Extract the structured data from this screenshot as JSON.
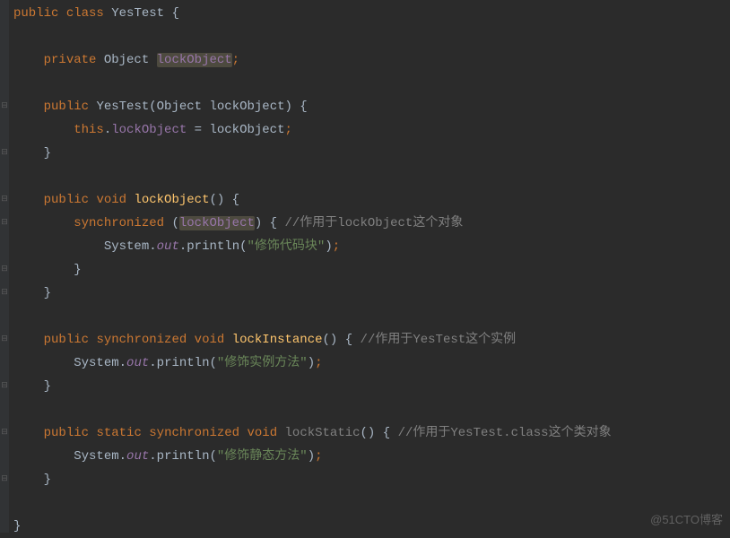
{
  "watermark": "@51CTO博客",
  "code": {
    "line1": {
      "kw1": "public",
      "kw2": "class",
      "cls": "YesTest",
      "brace": " {"
    },
    "line3": {
      "kw1": "private",
      "type": "Object",
      "field": "lockObject",
      "semi": ";"
    },
    "line5": {
      "kw1": "public",
      "ctor": "YesTest",
      "lparen": "(",
      "ptype": "Object",
      "pname": "lockObject",
      "rparen": ")",
      "brace": " {"
    },
    "line6": {
      "kw1": "this",
      "dot": ".",
      "field": "lockObject",
      "eq": " = ",
      "param": "lockObject",
      "semi": ";"
    },
    "line7": {
      "brace": "}"
    },
    "line9": {
      "kw1": "public",
      "kw2": "void",
      "method": "lockObject",
      "parens": "()",
      "brace": " {"
    },
    "line10": {
      "kw1": "synchronized",
      "lparen": " (",
      "field": "lockObject",
      "rparen": ")",
      "brace": " { ",
      "comment": "//作用于lockObject这个对象"
    },
    "line11": {
      "sys": "System",
      "dot1": ".",
      "out": "out",
      "dot2": ".",
      "print": "println",
      "lparen": "(",
      "str": "\"修饰代码块\"",
      "rparen": ")",
      "semi": ";"
    },
    "line12": {
      "brace": "}"
    },
    "line13": {
      "brace": "}"
    },
    "line15": {
      "kw1": "public",
      "kw2": "synchronized",
      "kw3": "void",
      "method": "lockInstance",
      "parens": "()",
      "brace": " { ",
      "comment": "//作用于YesTest这个实例"
    },
    "line16": {
      "sys": "System",
      "dot1": ".",
      "out": "out",
      "dot2": ".",
      "print": "println",
      "lparen": "(",
      "str": "\"修饰实例方法\"",
      "rparen": ")",
      "semi": ";"
    },
    "line17": {
      "brace": "}"
    },
    "line19": {
      "kw1": "public",
      "kw2": "static",
      "kw3": "synchronized",
      "kw4": "void",
      "method": "lockStatic",
      "parens": "()",
      "brace": " { ",
      "comment": "//作用于YesTest.class这个类对象"
    },
    "line20": {
      "sys": "System",
      "dot1": ".",
      "out": "out",
      "dot2": ".",
      "print": "println",
      "lparen": "(",
      "str": "\"修饰静态方法\"",
      "rparen": ")",
      "semi": ";"
    },
    "line21": {
      "brace": "}"
    },
    "line23": {
      "brace": "}"
    }
  }
}
